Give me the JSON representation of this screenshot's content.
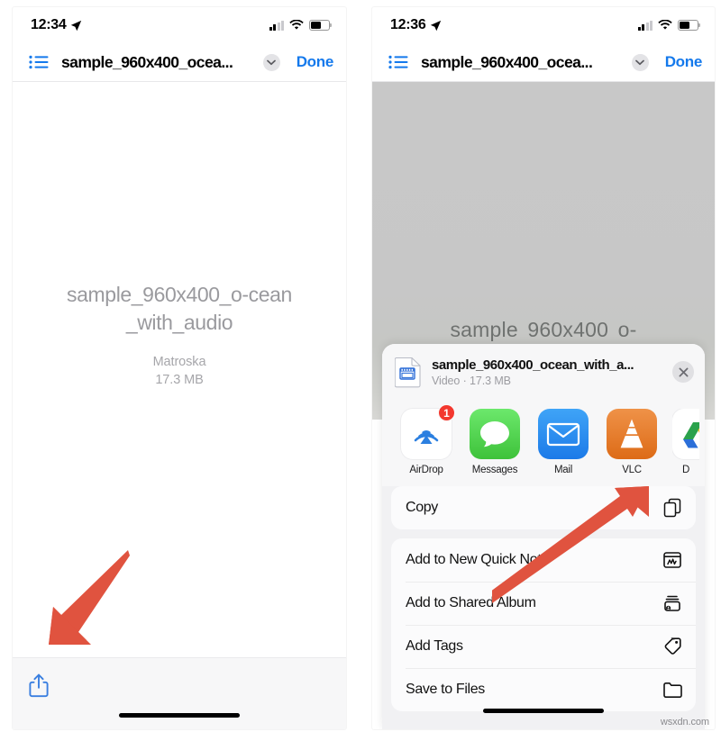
{
  "left_panel": {
    "status_bar": {
      "time": "12:34",
      "location_icon": "location-arrow-icon",
      "signal_icon": "cellular-signal-icon",
      "signal_bars_filled": 2,
      "signal_bars_total": 4,
      "wifi_icon": "wifi-icon",
      "battery_icon": "battery-icon",
      "battery_percent": 52
    },
    "navbar": {
      "list_icon": "bulleted-list-icon",
      "title": "sample_960x400_ocea...",
      "chevron_icon": "chevron-down-icon",
      "done_label": "Done"
    },
    "document": {
      "name": "sample_960x400_o-cean_with_audio",
      "kind": "Matroska",
      "size": "17.3 MB"
    },
    "bottom_bar": {
      "share_icon": "share-icon"
    }
  },
  "right_panel": {
    "status_bar": {
      "time": "12:36",
      "location_icon": "location-arrow-icon",
      "signal_icon": "cellular-signal-icon",
      "signal_bars_filled": 2,
      "signal_bars_total": 4,
      "wifi_icon": "wifi-icon",
      "battery_icon": "battery-icon",
      "battery_percent": 52
    },
    "navbar": {
      "list_icon": "bulleted-list-icon",
      "title": "sample_960x400_ocea...",
      "chevron_icon": "chevron-down-icon",
      "done_label": "Done"
    },
    "dimmed_document_name": "sample 960x400 o-",
    "share_sheet": {
      "file_icon": "video-file-icon",
      "file_name": "sample_960x400_ocean_with_a...",
      "file_subtitle": "Video · 17.3 MB",
      "close_icon": "close-icon",
      "apps": [
        {
          "label": "AirDrop",
          "icon": "airdrop-icon",
          "badge": "1"
        },
        {
          "label": "Messages",
          "icon": "messages-icon",
          "badge": ""
        },
        {
          "label": "Mail",
          "icon": "mail-icon",
          "badge": ""
        },
        {
          "label": "VLC",
          "icon": "vlc-cone-icon",
          "badge": ""
        },
        {
          "label": "D",
          "icon": "drive-icon",
          "badge": ""
        }
      ],
      "action_groups": [
        {
          "rows": [
            {
              "label": "Copy",
              "icon": "copy-icon"
            }
          ]
        },
        {
          "rows": [
            {
              "label": "Add to New Quick Note",
              "icon": "quick-note-icon"
            },
            {
              "label": "Add to Shared Album",
              "icon": "shared-album-icon"
            },
            {
              "label": "Add Tags",
              "icon": "tag-icon"
            },
            {
              "label": "Save to Files",
              "icon": "folder-icon"
            }
          ]
        }
      ]
    }
  },
  "annotations": {
    "left_arrow": "red-arrow-pointing-to-share-button",
    "right_arrow": "red-arrow-pointing-to-vlc-app"
  },
  "watermark": "wsxdn.com",
  "colors": {
    "accent_blue": "#1479ec",
    "badge_red": "#f3382f",
    "arrow_red": "#e0533f",
    "vlc_orange": "#e8762b",
    "messages_green": "#4cd964",
    "mail_blue": "#1f8df5",
    "sheet_bg": "#f1f1f3"
  }
}
